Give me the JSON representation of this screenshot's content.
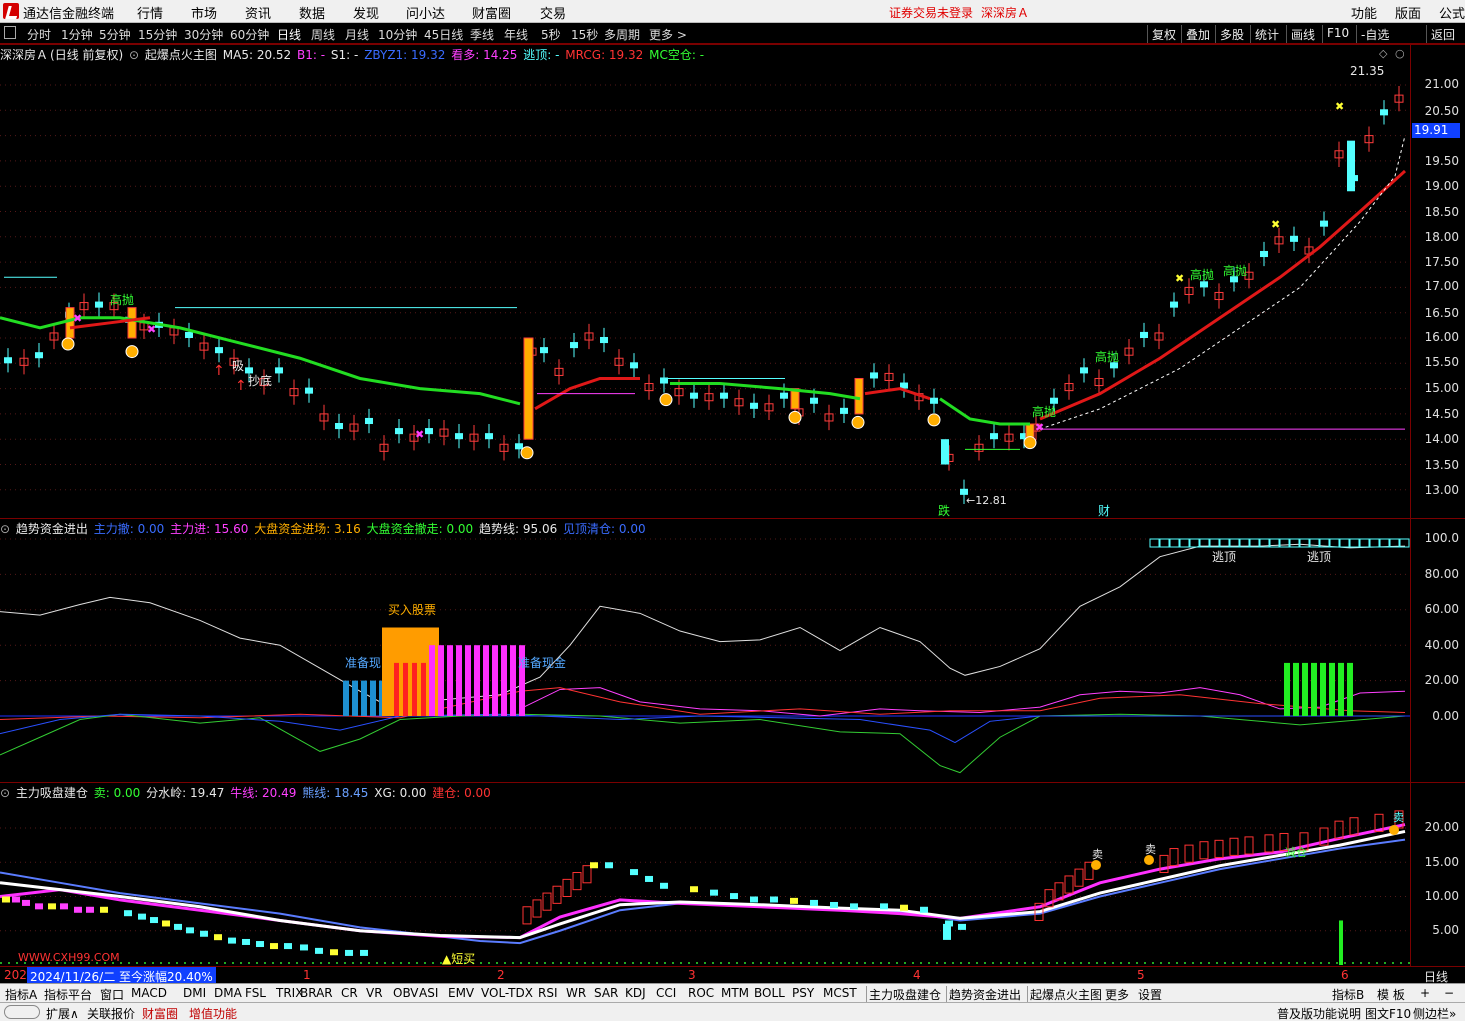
{
  "app": {
    "title": "通达信金融终端",
    "menu": [
      "行情",
      "市场",
      "资讯",
      "数据",
      "发现",
      "问小达",
      "财富圈",
      "交易"
    ],
    "notice_login": "证券交易未登录",
    "notice_stock": "深深房Ａ",
    "menu_right": [
      "功能",
      "版面",
      "公式"
    ]
  },
  "toolbar": {
    "periods": [
      "分时",
      "1分钟",
      "5分钟",
      "15分钟",
      "30分钟",
      "60分钟",
      "日线",
      "周线",
      "月线",
      "10分钟",
      "45日线",
      "季线",
      "年线",
      "5秒",
      "15秒",
      "多周期",
      "更多 >"
    ],
    "active_period": "日线",
    "right_buttons": [
      "复权",
      "叠加",
      "多股",
      "统计",
      "画线",
      "F10",
      "-自选",
      "返回"
    ]
  },
  "main_pane": {
    "legend": {
      "stock": "深深房Ａ",
      "mode": "(日线 前复权)",
      "formula": "起爆点火主图",
      "ma5": "MA5: 20.52",
      "b1": "B1: -",
      "s1": "S1: -",
      "zbyz": "ZBYZ1: 19.32",
      "kanduo": "看多: 14.25",
      "taoding": "逃顶: -",
      "mrcg": "MRCG: 19.32",
      "mc": "MC空仓: -"
    },
    "axis_ticks": [
      "21.00",
      "20.50",
      "19.50",
      "19.00",
      "18.50",
      "18.00",
      "17.50",
      "17.00",
      "16.50",
      "16.00",
      "15.50",
      "15.00",
      "14.50",
      "14.00",
      "13.50",
      "13.00"
    ],
    "current_price": "19.91",
    "high_label": "21.35",
    "annotations": {
      "gaopao": "高抛",
      "xishou": "吸",
      "chaodi": "抄底",
      "die": "跌",
      "cai": "财",
      "low_mark": "←12.81"
    },
    "colors": {
      "up": "#ff3c3c",
      "down": "#54ffff",
      "green_line": "#22dd22",
      "red_line": "#e01818"
    }
  },
  "sub1": {
    "legend": {
      "name": "趋势资金进出",
      "zhuli_chu": "主力撤: 0.00",
      "zhuli_jin": "主力进: 15.60",
      "dapan_jin": "大盘资金进场: 3.16",
      "dapan_chu": "大盘资金撤走: 0.00",
      "qushi": "趋势线: 95.06",
      "jianding": "见顶清仓: 0.00"
    },
    "axis_ticks": [
      "100.0",
      "80.00",
      "60.00",
      "40.00",
      "20.00",
      "0.00"
    ],
    "labels": {
      "buy": "买入股票",
      "prep1": "准备现",
      "prep2": "准备现金",
      "top1": "逃顶",
      "top2": "逃顶"
    }
  },
  "sub2": {
    "legend": {
      "name": "主力吸盘建仓",
      "mai": "卖: 0.00",
      "fenshuiling": "分水岭: 19.47",
      "niuxian": "牛线: 20.49",
      "xiongxian": "熊线: 18.45",
      "xg": "XG: 0.00",
      "jiancang": "建仓: 0.00"
    },
    "axis_ticks": [
      "20.00",
      "15.00",
      "10.00",
      "5.00"
    ],
    "labels": {
      "watermark": "WWW.CXH99.COM",
      "duanmai": "▲短买",
      "sell1": "卖",
      "sell2": "卖",
      "sell3": "卖",
      "jian": "减仓"
    }
  },
  "datebar": {
    "year_prefix": "202",
    "date": "2024/11/26/二",
    "change": "至今涨幅20.40%",
    "months": [
      "1",
      "2",
      "3",
      "4",
      "5",
      "6"
    ],
    "period": "日线"
  },
  "tabs": {
    "items": [
      "指标A",
      "指标平台",
      "窗口",
      "MACD",
      "DMI",
      "DMA",
      "FSL",
      "TRIX",
      "BRAR",
      "CR",
      "VR",
      "OBV",
      "ASI",
      "EMV",
      "VOL-TDX",
      "RSI",
      "WR",
      "SAR",
      "KDJ",
      "CCI",
      "ROC",
      "MTM",
      "BOLL",
      "PSY",
      "MCST",
      "主力吸盘建仓",
      "趋势资金进出",
      "起爆点火主图",
      "更多",
      "设置"
    ],
    "right": [
      "指标B",
      "模 板",
      "+",
      "−"
    ]
  },
  "status": {
    "items": [
      "扩展∧",
      "关联报价",
      "财富圈",
      "增值功能"
    ],
    "right": [
      "普及版功能说明",
      "图文F10",
      "侧边栏»"
    ]
  }
}
